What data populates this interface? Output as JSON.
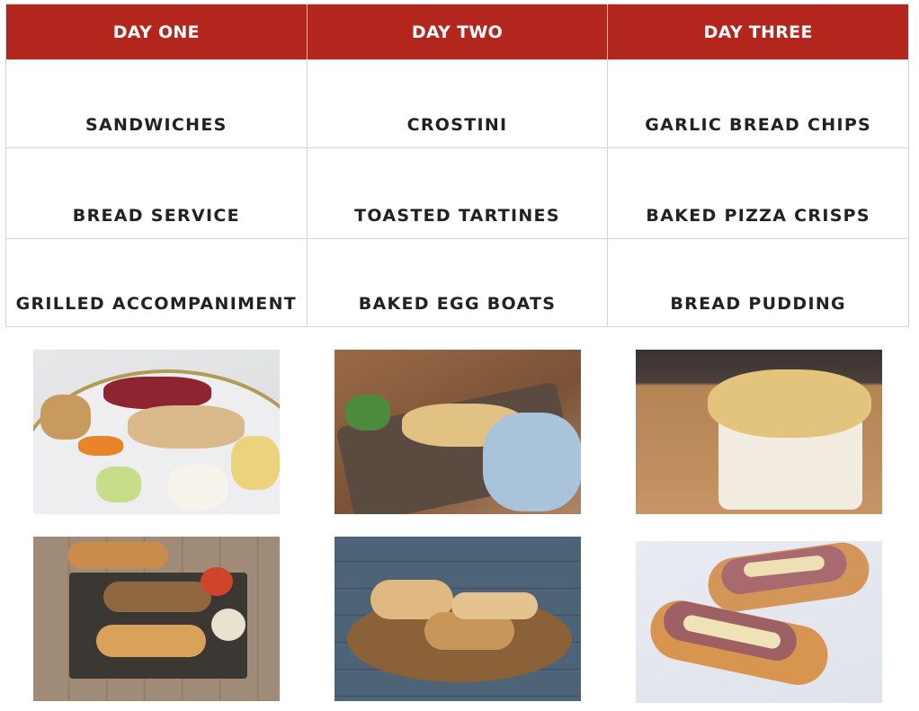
{
  "menu": {
    "headers": [
      "DAY ONE",
      "DAY TWO",
      "DAY THREE"
    ],
    "rows": [
      [
        "SANDWICHES",
        "CROSTINI",
        "GARLIC BREAD CHIPS"
      ],
      [
        "BREAD SERVICE",
        "TOASTED TARTINES",
        "BAKED PIZZA CRISPS"
      ],
      [
        "GRILLED ACCOMPANIMENT",
        "BAKED EGG BOATS",
        "BREAD PUDDING"
      ]
    ]
  },
  "colors": {
    "header_bg": "#b2261e",
    "header_text": "#ffffff",
    "cell_text": "#222222",
    "grid": "#d4d4d4"
  },
  "photos": [
    {
      "name": "bread-service-cheese-platter-photo",
      "description": "Cheese and charcuterie platter with sliced baguette"
    },
    {
      "name": "garlic-bread-board-photo",
      "description": "Garlic bread on wooden serving board"
    },
    {
      "name": "bread-pudding-souffle-photo",
      "description": "Bread pudding in white ramekin"
    },
    {
      "name": "pizza-tartines-rack-photo",
      "description": "Baguette pizza tartines on cooling rack"
    },
    {
      "name": "steak-sandwich-board-photo",
      "description": "Steak sandwiches on round wooden board"
    },
    {
      "name": "steak-crostini-photo",
      "description": "Steak crostini with sauce"
    }
  ]
}
